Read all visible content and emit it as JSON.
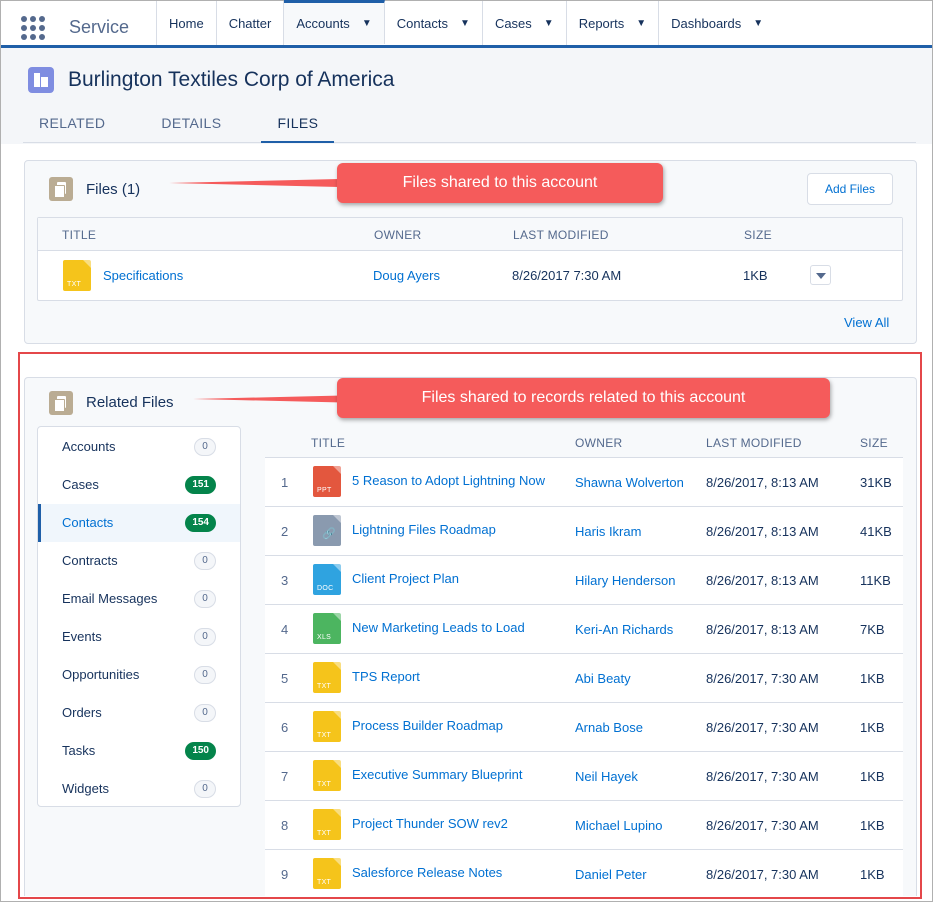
{
  "topnav": {
    "app_name": "Service",
    "items": [
      {
        "label": "Home",
        "dropdown": false
      },
      {
        "label": "Chatter",
        "dropdown": false
      },
      {
        "label": "Accounts",
        "dropdown": true,
        "active": true
      },
      {
        "label": "Contacts",
        "dropdown": true
      },
      {
        "label": "Cases",
        "dropdown": true
      },
      {
        "label": "Reports",
        "dropdown": true
      },
      {
        "label": "Dashboards",
        "dropdown": true
      }
    ]
  },
  "record": {
    "title": "Burlington Textiles Corp of America",
    "tabs": [
      "RELATED",
      "DETAILS",
      "FILES"
    ],
    "active_tab": "FILES"
  },
  "files_card": {
    "title": "Files (1)",
    "add_button": "Add Files",
    "columns": [
      "TITLE",
      "OWNER",
      "LAST MODIFIED",
      "SIZE"
    ],
    "rows": [
      {
        "title": "Specifications",
        "ext": "TXT",
        "owner": "Doug Ayers",
        "modified": "8/26/2017 7:30 AM",
        "size": "1KB"
      }
    ],
    "view_all": "View All"
  },
  "callouts": {
    "files": "Files shared to this account",
    "related": "Files shared to records related to this account"
  },
  "related_card": {
    "title": "Related Files",
    "objects": [
      {
        "label": "Accounts",
        "count": "0"
      },
      {
        "label": "Cases",
        "count": "151"
      },
      {
        "label": "Contacts",
        "count": "154",
        "active": true
      },
      {
        "label": "Contracts",
        "count": "0"
      },
      {
        "label": "Email Messages",
        "count": "0"
      },
      {
        "label": "Events",
        "count": "0"
      },
      {
        "label": "Opportunities",
        "count": "0"
      },
      {
        "label": "Orders",
        "count": "0"
      },
      {
        "label": "Tasks",
        "count": "150"
      },
      {
        "label": "Widgets",
        "count": "0"
      }
    ],
    "columns": [
      "TITLE",
      "OWNER",
      "LAST MODIFIED",
      "SIZE"
    ],
    "rows": [
      {
        "num": "1",
        "title": "5 Reason to Adopt Lightning Now",
        "ext": "PPT",
        "owner": "Shawna Wolverton",
        "modified": "8/26/2017, 8:13 AM",
        "size": "31KB"
      },
      {
        "num": "2",
        "title": "Lightning Files Roadmap",
        "ext": "LINK",
        "owner": "Haris Ikram",
        "modified": "8/26/2017, 8:13 AM",
        "size": "41KB"
      },
      {
        "num": "3",
        "title": "Client Project Plan",
        "ext": "DOC",
        "owner": "Hilary Henderson",
        "modified": "8/26/2017, 8:13 AM",
        "size": "11KB"
      },
      {
        "num": "4",
        "title": "New Marketing Leads to Load",
        "ext": "XLS",
        "owner": "Keri-An Richards",
        "modified": "8/26/2017, 8:13 AM",
        "size": "7KB"
      },
      {
        "num": "5",
        "title": "TPS Report",
        "ext": "TXT",
        "owner": "Abi Beaty",
        "modified": "8/26/2017, 7:30 AM",
        "size": "1KB"
      },
      {
        "num": "6",
        "title": "Process Builder Roadmap",
        "ext": "TXT",
        "owner": "Arnab Bose",
        "modified": "8/26/2017, 7:30 AM",
        "size": "1KB"
      },
      {
        "num": "7",
        "title": "Executive Summary Blueprint",
        "ext": "TXT",
        "owner": "Neil Hayek",
        "modified": "8/26/2017, 7:30 AM",
        "size": "1KB"
      },
      {
        "num": "8",
        "title": "Project Thunder SOW rev2",
        "ext": "TXT",
        "owner": "Michael Lupino",
        "modified": "8/26/2017, 7:30 AM",
        "size": "1KB"
      },
      {
        "num": "9",
        "title": "Salesforce Release Notes",
        "ext": "TXT",
        "owner": "Daniel Peter",
        "modified": "8/26/2017, 7:30 AM",
        "size": "1KB"
      }
    ]
  },
  "colors": {
    "ppt": "#e3573e",
    "link": "#8a9aaf",
    "doc": "#2fa3e0",
    "xls": "#4cb560",
    "txt": "#f5c41b",
    "callout": "#f55b5b",
    "highlight": "#e4474a"
  }
}
